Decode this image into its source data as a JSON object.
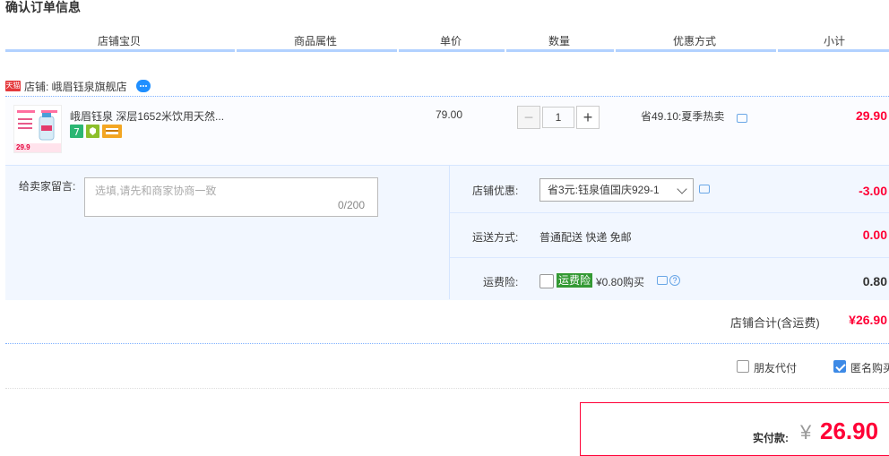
{
  "page": {
    "title": "确认订单信息"
  },
  "columns": [
    "店铺宝贝",
    "商品属性",
    "单价",
    "数量",
    "优惠方式",
    "小计"
  ],
  "shop": {
    "badge": "天猫",
    "label": "店铺: 峨眉钰泉旗舰店"
  },
  "item": {
    "name": "峨眉钰泉 深层1652米饮用天然...",
    "thumb_price": "29.9",
    "unit_price": "79.00",
    "quantity": "1",
    "minus": "−",
    "plus": "+",
    "promo": "省49.10:夏季热卖",
    "subtotal": "29.90"
  },
  "message": {
    "label": "给卖家留言:",
    "placeholder": "选填,请先和商家协商一致",
    "count": "0/200"
  },
  "shop_discount": {
    "label": "店铺优惠:",
    "selected": "省3元:钰泉值国庆929-1",
    "amount": "-3.00"
  },
  "shipping": {
    "label": "运送方式:",
    "value": "普通配送 快递 免邮",
    "amount": "0.00"
  },
  "insurance": {
    "label": "运费险:",
    "tag": "运费险",
    "text": "¥0.80购买",
    "help": "?",
    "amount": "0.80"
  },
  "shop_total": {
    "label": "店铺合计(含运费)",
    "amount": "¥26.90"
  },
  "options": {
    "friend_pay": "朋友代付",
    "anonymous": "匿名购买"
  },
  "payment": {
    "label": "实付款:",
    "currency": "¥",
    "amount": "26.90"
  },
  "colors": {
    "accent_red": "#ff0036",
    "header_line": "#b2d1ff",
    "panel_bg": "#f2f7ff",
    "insurance_green": "#339933"
  }
}
